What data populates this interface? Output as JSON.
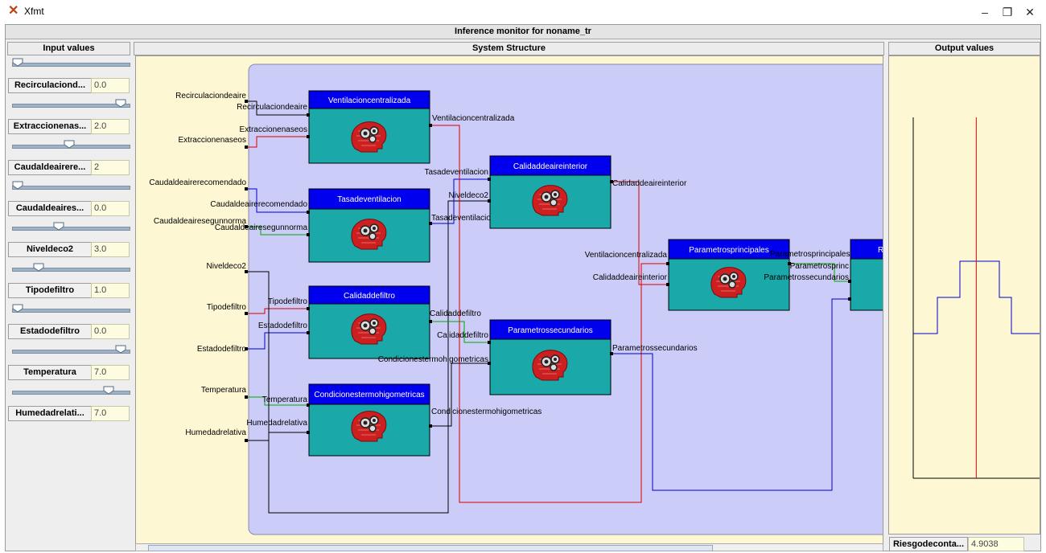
{
  "window": {
    "app_title": "Xfmt",
    "app_icon": "xfuzzy-x-icon",
    "monitor_title": "Inference monitor for noname_tr",
    "minimize_label": "–",
    "restore_label": "❐",
    "close_label": "✕"
  },
  "input_panel": {
    "header": "Input values",
    "inputs": [
      {
        "name": "Recirculaciond...",
        "value": "0.0",
        "slider": 0.0
      },
      {
        "name": "Extraccionenas...",
        "value": "2.0",
        "slider": 1.0
      },
      {
        "name": "Caudaldeairere...",
        "value": "2",
        "slider": 0.5
      },
      {
        "name": "Caudaldeaires...",
        "value": "0.0",
        "slider": 0.0
      },
      {
        "name": "Niveldeco2",
        "value": "3.0",
        "slider": 0.4
      },
      {
        "name": "Tipodefiltro",
        "value": "1.0",
        "slider": 0.2
      },
      {
        "name": "Estadodefiltro",
        "value": "0.0",
        "slider": 0.0
      },
      {
        "name": "Temperatura",
        "value": "7.0",
        "slider": 1.0
      },
      {
        "name": "Humedadrelati...",
        "value": "7.0",
        "slider": 0.88
      }
    ]
  },
  "structure_panel": {
    "header": "System Structure",
    "global_inputs": [
      "Recirculaciondeaire",
      "Extraccionenaseos",
      "Caudaldeairerecomendado",
      "Caudaldeairesegunnorma",
      "Niveldeco2",
      "Tipodefiltro",
      "Estadodefiltro",
      "Temperatura",
      "Humedadrelativa"
    ],
    "modules": {
      "ventilacion": {
        "title": "Ventilacioncentralizada",
        "inputs": [
          "Recirculaciondeaire",
          "Extraccionenaseos"
        ],
        "output": "Ventilacioncentralizada"
      },
      "tasa": {
        "title": "Tasadeventilacion",
        "inputs": [
          "Caudaldeairerecomendado",
          "Caudaldeairesegunnorma"
        ],
        "output": "Tasadeventilacion"
      },
      "calidad_filtro": {
        "title": "Calidaddefiltro",
        "inputs": [
          "Tipodefiltro",
          "Estadodefiltro"
        ],
        "output": "Calidaddefiltro"
      },
      "condiciones": {
        "title": "Condicionestermohigometricas",
        "inputs": [
          "Temperatura",
          "Humedadrelativa"
        ],
        "output": "Condicionestermohigometricas"
      },
      "calidad_aire": {
        "title": "Calidaddeaireinterior",
        "inputs": [
          "Tasadeventilacion",
          "Niveldeco2"
        ],
        "output": "Calidaddeaireinterior"
      },
      "param_sec": {
        "title": "Parametrossecundarios",
        "inputs": [
          "Calidaddefiltro",
          "Condicionestermohigometricas"
        ],
        "output": "Parametrossecundarios"
      },
      "param_pri": {
        "title": "Parametrosprincipales",
        "inputs": [
          "Ventilacioncentralizada",
          "Calidaddeaireinterior"
        ],
        "output": "Parametrosprincipales"
      },
      "riesgo": {
        "title": "Ri",
        "inputs": [
          "Parametrosprinc",
          "Parametrossecundarios"
        ]
      }
    },
    "labels": {
      "tasa_out_truncated": "Tasadeventilacio"
    }
  },
  "output_panel": {
    "header": "Output values",
    "output_name": "Riesgodeconta...",
    "output_value": "4.9038",
    "crisp_position": 0.55,
    "membership_levels": [
      0,
      0.45,
      0.7,
      0.45,
      0
    ]
  },
  "colors": {
    "block_title": "#0000ee",
    "block_body": "#1aa8a8",
    "group_bg": "#ccccf8",
    "wire_black": "#000000",
    "wire_red": "#dd0000",
    "wire_blue": "#0000cc",
    "wire_green": "#00aa00"
  }
}
